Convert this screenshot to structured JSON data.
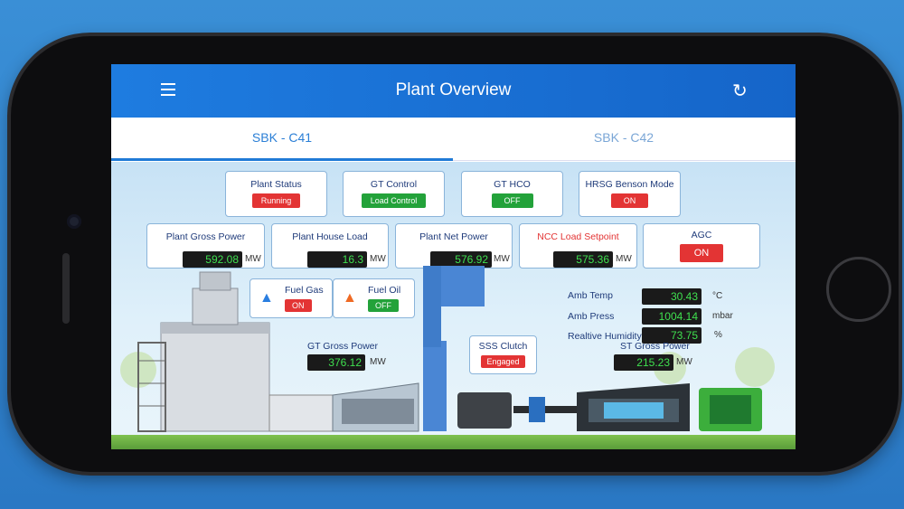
{
  "appbar": {
    "title": "Plant Overview",
    "menu_icon": "hamburger-menu-icon",
    "refresh_icon": "refresh-icon"
  },
  "tabs": [
    {
      "label": "SBK - C41"
    },
    {
      "label": "SBK - C42"
    }
  ],
  "status_cards": [
    {
      "label": "Plant Status",
      "value": "Running",
      "color": "#e33434"
    },
    {
      "label": "GT Control",
      "value": "Load Control",
      "color": "#23a23a"
    },
    {
      "label": "GT HCO",
      "value": "OFF",
      "color": "#23a23a"
    },
    {
      "label": "HRSG Benson Mode",
      "value": "ON",
      "color": "#e33434"
    }
  ],
  "power_cards": [
    {
      "label": "Plant Gross Power",
      "value": "592.08",
      "unit": "MW"
    },
    {
      "label": "Plant House Load",
      "value": "16.3",
      "unit": "MW"
    },
    {
      "label": "Plant Net Power",
      "value": "576.92",
      "unit": "MW"
    },
    {
      "label": "NCC Load Setpoint",
      "value": "575.36",
      "unit": "MW"
    }
  ],
  "agc": {
    "label": "AGC",
    "value": "ON"
  },
  "fuel": {
    "gas_label": "Fuel Gas",
    "gas_value": "ON",
    "oil_label": "Fuel Oil",
    "oil_value": "OFF"
  },
  "ambient": {
    "temp_label": "Amb Temp",
    "temp_value": "30.43",
    "temp_unit": "°C",
    "press_label": "Amb Press",
    "press_value": "1004.14",
    "press_unit": "mbar",
    "hum_label": "Realtive Humidity",
    "hum_value": "73.75",
    "hum_unit": "%"
  },
  "gt": {
    "label": "GT Gross Power",
    "value": "376.12",
    "unit": "MW"
  },
  "sss": {
    "label": "SSS Clutch",
    "value": "Engaged"
  },
  "st": {
    "label": "ST Gross Power",
    "value": "215.23",
    "unit": "MW"
  }
}
